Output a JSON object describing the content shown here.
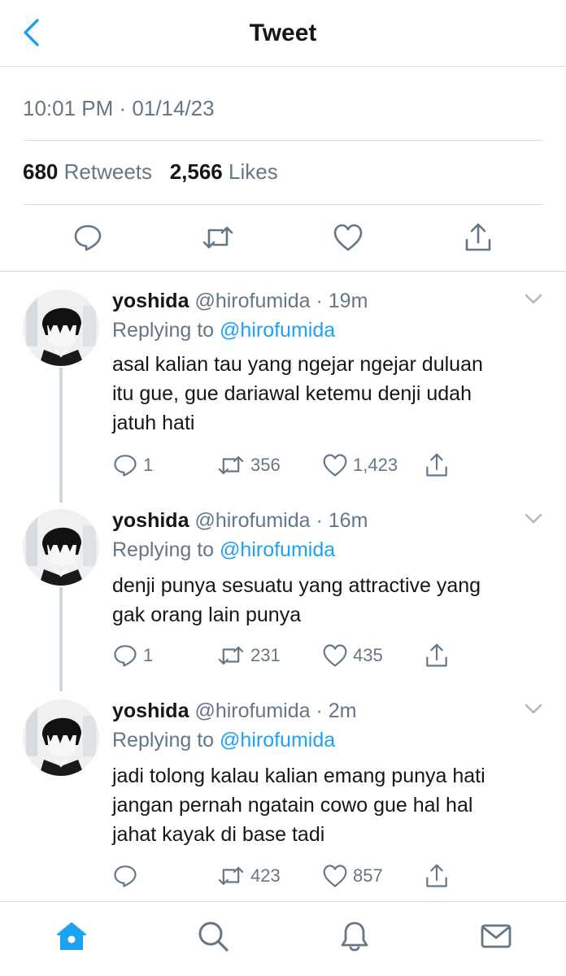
{
  "header": {
    "title": "Tweet"
  },
  "tweet": {
    "timestamp": "10:01 PM · 01/14/23",
    "retweets": "680",
    "retweets_label": "Retweets",
    "likes": "2,566",
    "likes_label": "Likes"
  },
  "replies": [
    {
      "name": "yoshida",
      "handle": "@hirofumida",
      "time": "· 19m",
      "replying_prefix": "Replying to",
      "replying_to": "@hirofumida",
      "lines": [
        "asal kalian tau yang ngejar ngejar duluan",
        "itu gue, gue dariawal ketemu denji udah",
        "jatuh hati"
      ],
      "replies_count": "1",
      "retweets_count": "356",
      "likes_count": "1,423"
    },
    {
      "name": "yoshida",
      "handle": "@hirofumida",
      "time": "· 16m",
      "replying_prefix": "Replying to",
      "replying_to": "@hirofumida",
      "lines": [
        "denji punya sesuatu yang attractive yang",
        "gak orang lain punya"
      ],
      "replies_count": "1",
      "retweets_count": "231",
      "likes_count": "435"
    },
    {
      "name": "yoshida",
      "handle": "@hirofumida",
      "time": "· 2m",
      "replying_prefix": "Replying to",
      "replying_to": "@hirofumida",
      "lines": [
        "jadi tolong kalau kalian emang punya hati",
        "jangan pernah ngatain cowo gue hal hal",
        "jahat kayak di base tadi"
      ],
      "replies_count": "",
      "retweets_count": "423",
      "likes_count": "857"
    }
  ],
  "icons": {
    "back": "chevron-left-icon",
    "reply": "speech-bubble-icon",
    "retweet": "retweet-icon",
    "like": "heart-icon",
    "share": "share-icon",
    "caret": "chevron-down-icon",
    "home": "home-icon",
    "search": "search-icon",
    "notifications": "bell-icon",
    "messages": "envelope-icon"
  },
  "colors": {
    "accent": "#1da1f2",
    "muted": "#657786",
    "text": "#14171a",
    "divider": "#dcdfe2"
  }
}
